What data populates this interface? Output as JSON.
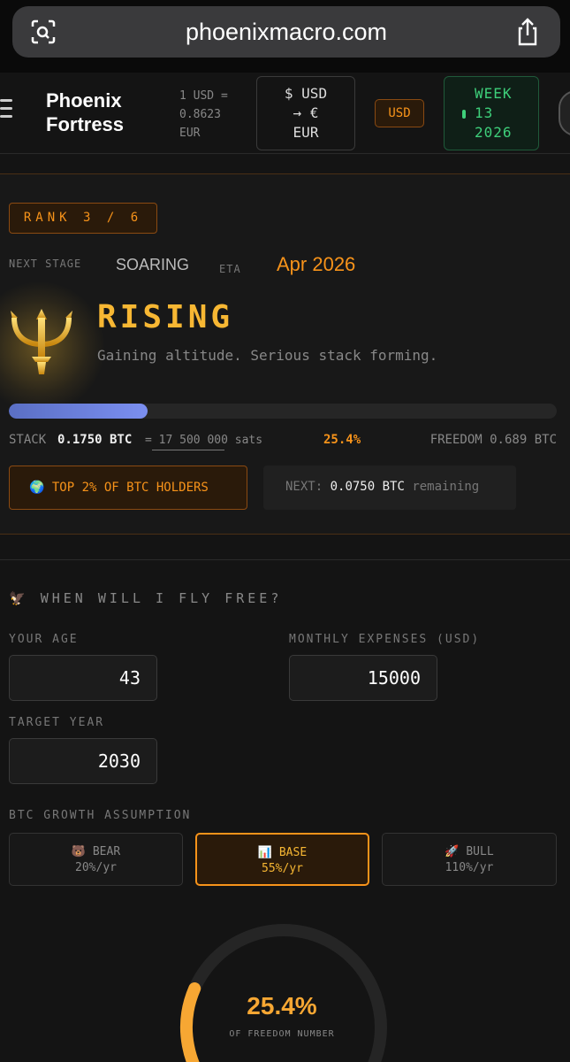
{
  "browser": {
    "url": "phoenixmacro.com"
  },
  "header": {
    "brand_line1": "Phoenix",
    "brand_line2": "Fortress",
    "rate_line1": "1 USD =",
    "rate_line2": "0.8623",
    "rate_line3": "EUR",
    "conv_line1": "$ USD",
    "conv_line2": "→ €",
    "conv_line3": "EUR",
    "currency": "USD",
    "week_line1": "WEEK",
    "week_line2": "13",
    "week_line3": "2026"
  },
  "rank": {
    "badge": "RANK 3 / 6",
    "next_stage_label": "NEXT STAGE",
    "next_stage": "SOARING",
    "eta_label": "ETA",
    "eta": "Apr 2026",
    "level": "RISING",
    "description": "Gaining altitude. Serious stack forming.",
    "progress_fraction": 0.254,
    "stack_label": "STACK",
    "stack": "0.1750 BTC",
    "sats": "= 17 500 000 sats",
    "percent": "25.4%",
    "freedom": "FREEDOM 0.689 BTC",
    "top_badge": "🌍 TOP 2% OF BTC HOLDERS",
    "next_label": "NEXT:",
    "next_value": "0.0750 BTC",
    "next_suffix": "remaining"
  },
  "calculator": {
    "title": "🦅 WHEN WILL I FLY FREE?",
    "age_label": "YOUR AGE",
    "age": "43",
    "expenses_label": "MONTHLY EXPENSES (USD)",
    "expenses": "15000",
    "target_label": "TARGET YEAR",
    "target": "2030",
    "growth_label": "BTC GROWTH ASSUMPTION",
    "scenarios": [
      {
        "label": "🐻 BEAR",
        "rate": "20%/yr"
      },
      {
        "label": "📊 BASE",
        "rate": "55%/yr"
      },
      {
        "label": "🚀 BULL",
        "rate": "110%/yr"
      }
    ],
    "gauge_fraction": 0.254,
    "gauge_value": "25.4%",
    "gauge_label": "OF FREEDOM NUMBER"
  },
  "colors": {
    "accent": "#f7931a",
    "gold": "#f7b733",
    "green": "#3ecf7a",
    "progress": "#6b7fe0"
  }
}
